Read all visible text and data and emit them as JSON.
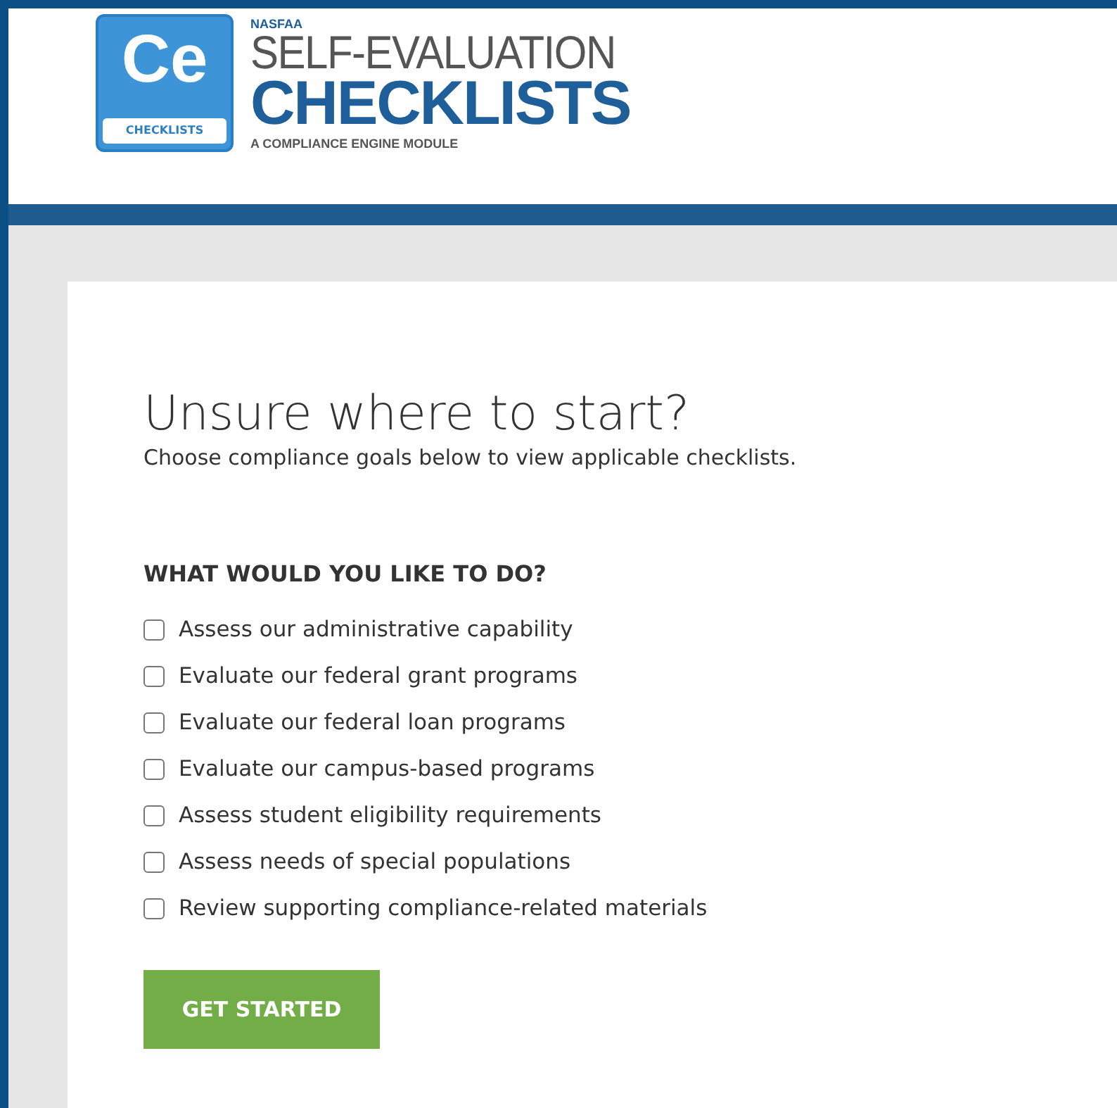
{
  "logo": {
    "mark": "Ce",
    "badge": "CHECKLISTS",
    "org": "NASFAA",
    "line1": "SELF-EVALUATION",
    "line2": "CHECKLISTS",
    "tagline": "A COMPLIANCE ENGINE MODULE"
  },
  "card": {
    "title": "Unsure where to start?",
    "subtitle": "Choose compliance goals below to view applicable checklists.",
    "question": "WHAT WOULD YOU LIKE TO DO?",
    "options": [
      {
        "label": "Assess our administrative capability",
        "checked": false
      },
      {
        "label": "Evaluate our federal grant programs",
        "checked": false
      },
      {
        "label": "Evaluate our federal loan programs",
        "checked": false
      },
      {
        "label": "Evaluate our campus-based programs",
        "checked": false
      },
      {
        "label": "Assess student eligibility requirements",
        "checked": false
      },
      {
        "label": "Assess needs of special populations",
        "checked": false
      },
      {
        "label": "Review supporting compliance-related materials",
        "checked": false
      }
    ],
    "button": "GET STARTED"
  }
}
